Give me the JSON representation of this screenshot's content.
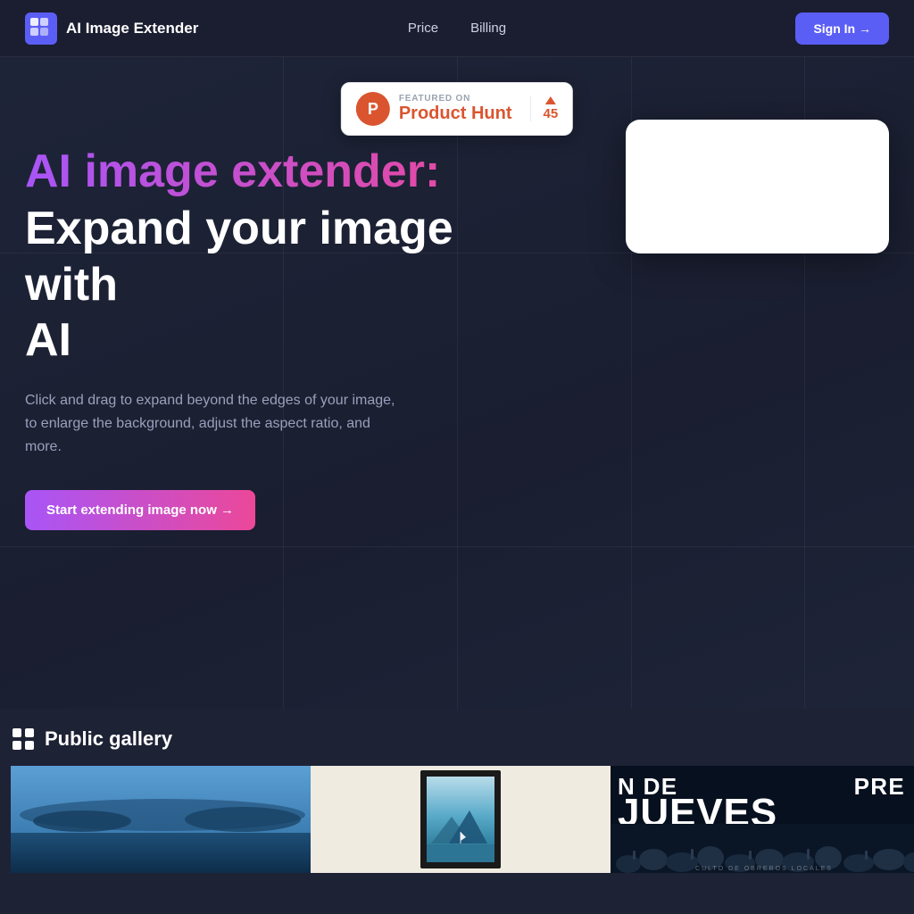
{
  "nav": {
    "logo_text": "AI Image Extender",
    "links": [
      {
        "label": "Price",
        "id": "price"
      },
      {
        "label": "Billing",
        "id": "billing"
      }
    ],
    "signin_label": "Sign In →"
  },
  "product_hunt": {
    "featured_label": "FEATURED ON",
    "name": "Product Hunt",
    "vote_count": "45"
  },
  "hero": {
    "title_colored": "AI image extender:",
    "title_white_line1": "Expand your image with",
    "title_white_line2": "AI",
    "description": "Click and drag to expand beyond the edges of your image, to enlarge the background, adjust the aspect ratio, and more.",
    "cta_label": "Start extending image now →"
  },
  "gallery": {
    "title": "Public gallery",
    "icon_label": "gallery-icon",
    "items": [
      {
        "id": "gallery-blue-landscape",
        "alt": "Blue landscape"
      },
      {
        "id": "gallery-framed-painting",
        "alt": "Framed painting"
      },
      {
        "id": "gallery-jueves-poster",
        "alt": "Jueves poster",
        "text_de": "N DE",
        "text_jueves": "JUEVES",
        "text_pre": "PRE",
        "subtext": "CULTO DE OBREROS LOCALES"
      }
    ]
  }
}
